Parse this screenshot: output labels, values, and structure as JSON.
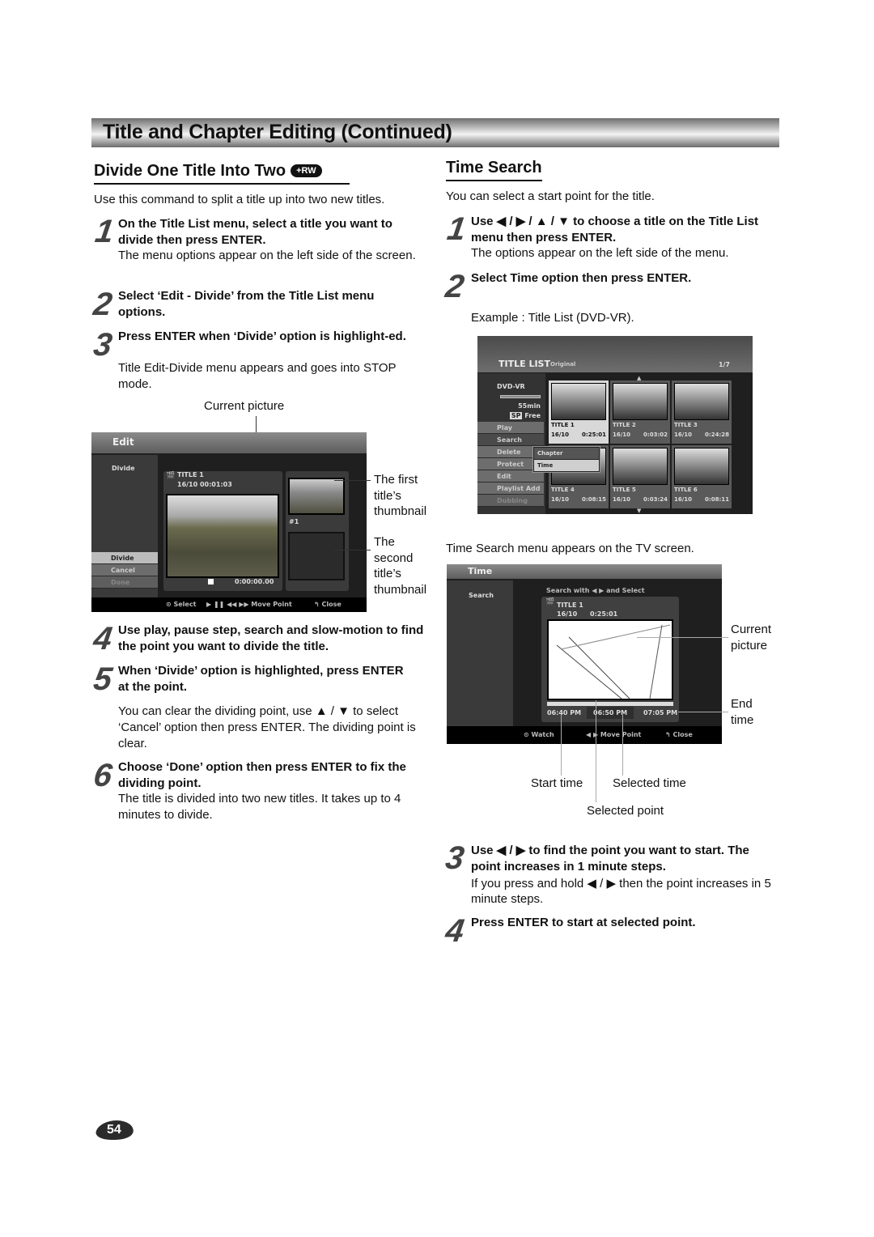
{
  "header": {
    "title": "Title and Chapter Editing (Continued)"
  },
  "left": {
    "title": "Divide One Title Into Two",
    "badge": "+RW",
    "intro": "Use this command to split a title up into two new titles.",
    "steps": [
      {
        "num": "1",
        "bold": "On the Title List menu, select a title you want to divide then press ENTER.",
        "text": "The menu options appear on the left side of the screen."
      },
      {
        "num": "2",
        "bold": "Select ‘Edit - Divide’ from the Title List menu options.",
        "text": ""
      },
      {
        "num": "3",
        "bold": "Press ENTER when ‘Divide’ option is highlight-ed.",
        "text": "Title Edit-Divide menu appears and goes into STOP mode."
      },
      {
        "num": "4",
        "bold": "Use play, pause step, search and slow-motion to find the point you want to divide the title.",
        "text": ""
      },
      {
        "num": "5",
        "bold": "When ‘Divide’ option is highlighted, press ENTER at the point.",
        "text": "You can clear the dividing point, use ▲ / ▼ to select ‘Cancel’ option then press ENTER. The dividing point is clear."
      },
      {
        "num": "6",
        "bold": "Choose ‘Done’ option then press ENTER to fix the dividing point.",
        "text": "The title is divided into two new titles. It takes up to 4 minutes to divide."
      }
    ],
    "callouts": {
      "current_picture": "Current picture",
      "first_thumb": "The first title’s thumbnail",
      "second_thumb": "The second title’s thumbnail"
    },
    "edit_screen": {
      "header": "Edit",
      "side_label": "Divide",
      "menu": [
        "Divide",
        "Cancel",
        "Done"
      ],
      "title": "TITLE 1",
      "date_time": "16/10  00:01:03",
      "thumb_label": "#1",
      "counter": "0:00:00.00",
      "footer": {
        "select": "⊙ Select",
        "move": "▶ ❚❚ ◀◀ ▶▶  Move Point",
        "close": "↰ Close"
      }
    }
  },
  "right": {
    "title": "Time Search",
    "intro": "You can select a start point for the title.",
    "steps": [
      {
        "num": "1",
        "bold": "Use ◀ / ▶ / ▲ / ▼ to choose a title on the Title List menu then press ENTER.",
        "text": "The options appear on the left side of the menu."
      },
      {
        "num": "2",
        "bold": "Select Time option then press ENTER.",
        "text": ""
      },
      {
        "num": "3",
        "bold": "Use ◀ / ▶ to find the point you want to start. The point increases in 1 minute steps.",
        "text": "If you press and hold ◀ / ▶ then the point increases in 5 minute steps."
      },
      {
        "num": "4",
        "bold": "Press ENTER to start at selected point.",
        "text": ""
      }
    ],
    "example": "Example : Title List (DVD-VR).",
    "after_list": "Time Search menu appears on the TV screen.",
    "title_list_screen": {
      "header": "TITLE LIST",
      "sub": "Original",
      "page": "1/7",
      "disc": "DVD-VR",
      "remaining": "55min",
      "mode": "SP",
      "free": "Free",
      "menu": [
        "Play",
        "Search",
        "Delete",
        "Protect",
        "Edit",
        "Playlist Add",
        "Dubbing"
      ],
      "submenu": [
        "Chapter",
        "Time"
      ],
      "titles": [
        {
          "name": "TITLE 1",
          "date": "16/10",
          "length": "0:25:01"
        },
        {
          "name": "TITLE 2",
          "date": "16/10",
          "length": "0:03:02"
        },
        {
          "name": "TITLE 3",
          "date": "16/10",
          "length": "0:24:28"
        },
        {
          "name": "TITLE 4",
          "date": "16/10",
          "length": "0:08:15"
        },
        {
          "name": "TITLE 5",
          "date": "16/10",
          "length": "0:03:24"
        },
        {
          "name": "TITLE 6",
          "date": "16/10",
          "length": "0:08:11"
        }
      ]
    },
    "time_screen": {
      "header": "Time",
      "side_label": "Search",
      "hint": "Search with ◀ ▶ and Select",
      "title": "TITLE 1",
      "date": "16/10",
      "length": "0:25:01",
      "start_time": "06:40 PM",
      "selected_time": "06:50 PM",
      "end_time": "07:05 PM",
      "footer": {
        "watch": "⊙ Watch",
        "move": "◀ ▶ Move Point",
        "close": "↰ Close"
      }
    },
    "callouts": {
      "current_picture": "Current picture",
      "end_time": "End time",
      "start_time": "Start time",
      "selected_time": "Selected time",
      "selected_point": "Selected point"
    }
  },
  "page_number": "54"
}
